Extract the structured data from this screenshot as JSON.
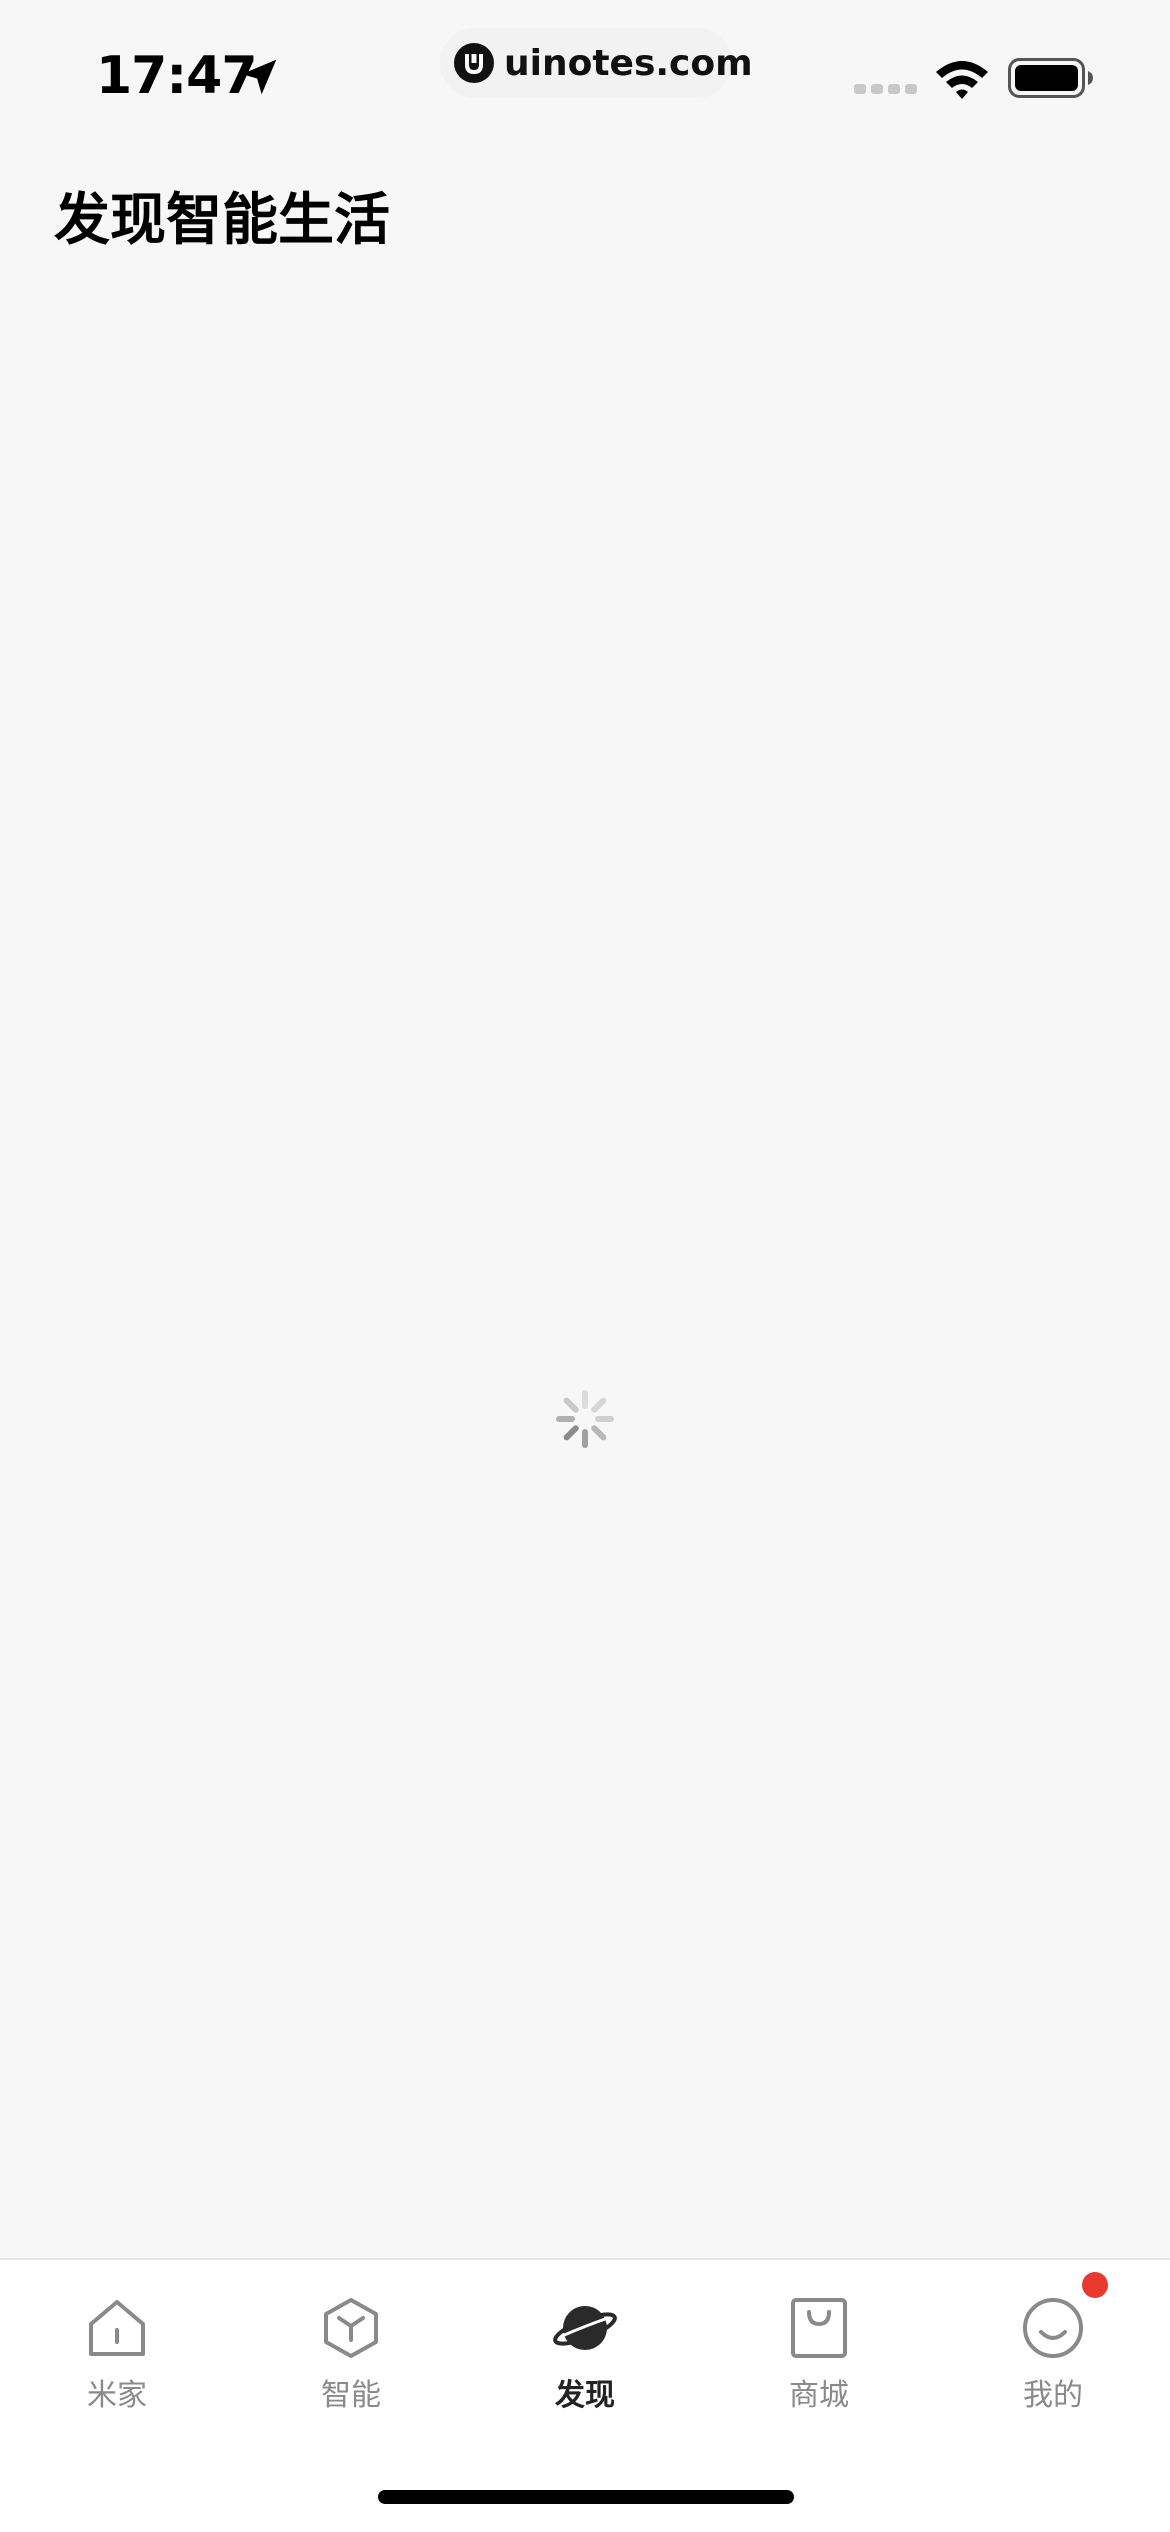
{
  "status_bar": {
    "time": "17:47",
    "url": "uinotes.com",
    "icons": [
      "location-arrow-icon",
      "cellular-signal-icon",
      "wifi-icon",
      "battery-icon"
    ]
  },
  "header": {
    "title": "发现智能生活"
  },
  "content": {
    "state": "loading",
    "icon": "loading-spinner-icon"
  },
  "tab_bar": {
    "active_index": 2,
    "items": [
      {
        "label": "米家",
        "icon": "home-icon"
      },
      {
        "label": "智能",
        "icon": "cube-icon"
      },
      {
        "label": "发现",
        "icon": "planet-icon"
      },
      {
        "label": "商城",
        "icon": "shopping-bag-icon"
      },
      {
        "label": "我的",
        "icon": "smiley-face-icon"
      }
    ]
  },
  "colors": {
    "background": "#f7f7f7",
    "tab_bar_background": "#ffffff",
    "tab_inactive": "#8a8a8a",
    "tab_active": "#222222",
    "badge": "#e8392f"
  }
}
